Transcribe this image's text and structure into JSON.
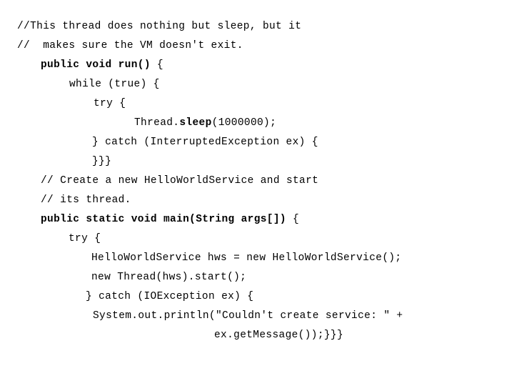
{
  "slide": {
    "background_color": "#ffffff",
    "text_color": "#000000",
    "code_lines": [
      {
        "indent_class": "ind-0",
        "text": "//This thread does nothing but sleep, but it",
        "segments": [
          {
            "text": "//This thread does nothing but sleep, but it",
            "bold": false
          }
        ]
      },
      {
        "indent_class": "ind-0",
        "text": "//  makes sure the VM doesn't exit.",
        "segments": [
          {
            "text": "//  makes sure the VM doesn't exit.",
            "bold": false
          }
        ]
      },
      {
        "indent_class": "ind-1",
        "text": "public void run() {",
        "segments": [
          {
            "text": "public void run()",
            "bold": true
          },
          {
            "text": " {",
            "bold": false
          }
        ]
      },
      {
        "indent_class": "ind-2",
        "text": "while (true) {",
        "segments": [
          {
            "text": "while (true) {",
            "bold": false
          }
        ]
      },
      {
        "indent_class": "ind-3",
        "text": "try {",
        "segments": [
          {
            "text": "try {",
            "bold": false
          }
        ]
      },
      {
        "indent_class": "ind-4",
        "text": "Thread.sleep(1000000);",
        "segments": [
          {
            "text": "Thread.",
            "bold": false
          },
          {
            "text": "sleep",
            "bold": true
          },
          {
            "text": "(1000000);",
            "bold": false
          }
        ]
      },
      {
        "indent_class": "ind-5",
        "text": "} catch (InterruptedException ex) {",
        "segments": [
          {
            "text": "} catch (InterruptedException ex) {",
            "bold": false
          }
        ]
      },
      {
        "indent_class": "ind-5",
        "text": "}}}",
        "segments": [
          {
            "text": "}}}",
            "bold": false
          }
        ]
      },
      {
        "indent_class": "ind-6",
        "text": "// Create a new HelloWorldService and start",
        "segments": [
          {
            "text": "// Create a new HelloWorldService and start",
            "bold": false
          }
        ]
      },
      {
        "indent_class": "ind-6",
        "text": "// its thread.",
        "segments": [
          {
            "text": "// its thread.",
            "bold": false
          }
        ]
      },
      {
        "indent_class": "ind-6",
        "text": "public static void main(String args[]) {",
        "segments": [
          {
            "text": "public static void main(String args[])",
            "bold": true
          },
          {
            "text": " {",
            "bold": false
          }
        ]
      },
      {
        "indent_class": "ind-7",
        "text": "try {",
        "segments": [
          {
            "text": "try {",
            "bold": false
          }
        ]
      },
      {
        "indent_class": "ind-8",
        "text": "HelloWorldService hws = new HelloWorldService();",
        "segments": [
          {
            "text": "HelloWorldService hws = new HelloWorldService();",
            "bold": false
          }
        ]
      },
      {
        "indent_class": "ind-8",
        "text": "new Thread(hws).start();",
        "segments": [
          {
            "text": "new Thread(hws).start();",
            "bold": false
          }
        ]
      },
      {
        "indent_class": "ind-9",
        "text": "} catch (IOException ex) {",
        "segments": [
          {
            "text": "} catch (IOException ex) {",
            "bold": false
          }
        ]
      },
      {
        "indent_class": "ind-10",
        "text": "System.out.println(\"Couldn't create service: \" +",
        "segments": [
          {
            "text": "System.out.println(\"Couldn't create service: \" +",
            "bold": false
          }
        ]
      },
      {
        "indent_class": "ind-11",
        "text": "ex.getMessage());}}}",
        "segments": [
          {
            "text": "ex.getMessage());}}}",
            "bold": false
          }
        ]
      }
    ]
  }
}
